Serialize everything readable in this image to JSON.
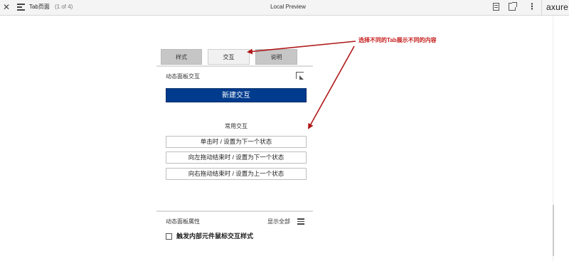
{
  "toolbar": {
    "page_name": "Tab页面",
    "page_count": "(1 of 4)",
    "title": "Local Preview",
    "brand": "axure",
    "icons": [
      "close-icon",
      "menu-icon",
      "notes-icon",
      "share-icon",
      "more-icon"
    ]
  },
  "panel": {
    "tabs": [
      {
        "label": "样式",
        "active": false
      },
      {
        "label": "交互",
        "active": true
      },
      {
        "label": "说明",
        "active": false
      }
    ],
    "section_title": "动态面板交互",
    "new_interaction_label": "新建交互",
    "common_title": "常用交互",
    "presets": [
      "单击时 / 设置为下一个状态",
      "向左拖动结束时 / 设置为下一个状态",
      "向右拖动结束时 / 设置为上一个状态"
    ],
    "properties_title": "动态面板属性",
    "show_all_label": "显示全部",
    "checkbox_label": "触发内部元件鼠标交互样式",
    "checkbox_checked": false
  },
  "annotation": {
    "text": "选择不同的Tab展示不同的内容",
    "color": "#c61d1d"
  },
  "colors": {
    "primary_button": "#003b8e",
    "tab_inactive": "#c6c6c6",
    "tab_active": "#f1f1f1"
  }
}
